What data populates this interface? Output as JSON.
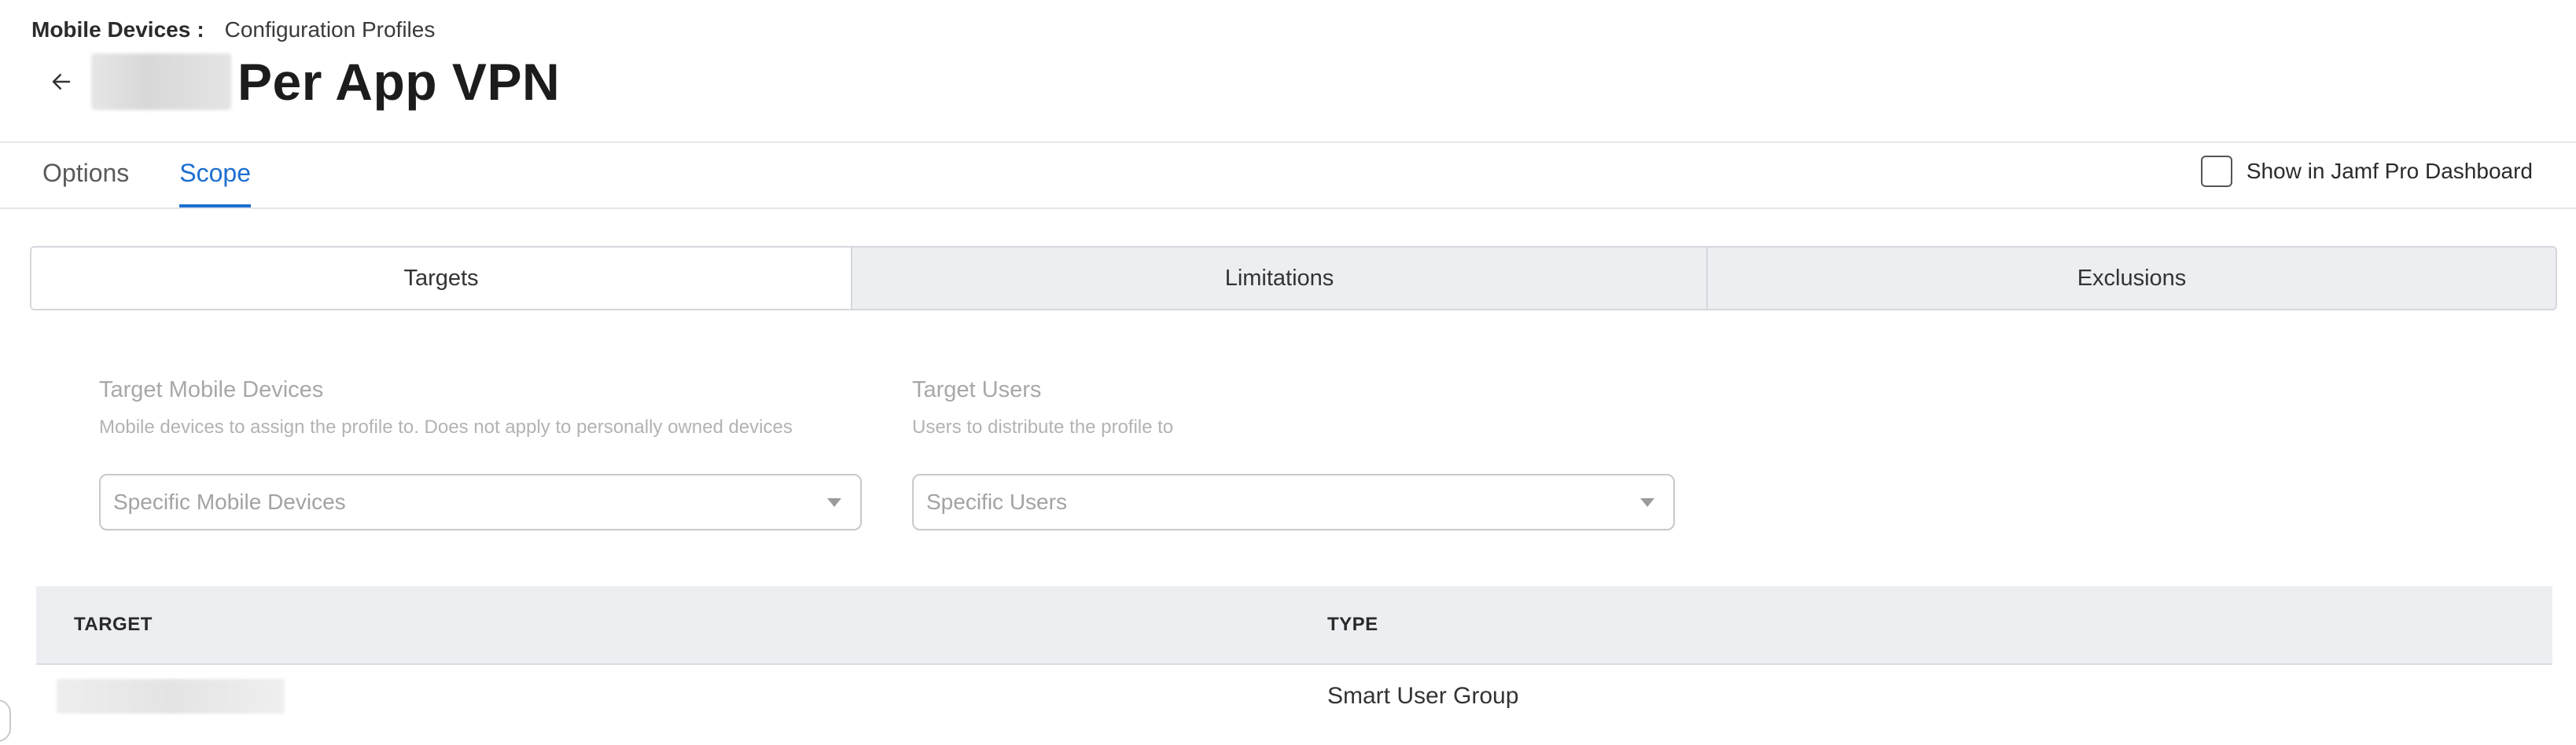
{
  "breadcrumb": {
    "root": "Mobile Devices",
    "separator": ":",
    "current": "Configuration Profiles"
  },
  "header": {
    "title": "Per App VPN",
    "back_icon": "arrow-left-icon"
  },
  "tabs": [
    {
      "label": "Options",
      "active": false
    },
    {
      "label": "Scope",
      "active": true
    }
  ],
  "dashboard_checkbox": {
    "label": "Show in Jamf Pro Dashboard",
    "checked": false
  },
  "scope_sections": [
    {
      "label": "Targets",
      "active": true
    },
    {
      "label": "Limitations",
      "active": false
    },
    {
      "label": "Exclusions",
      "active": false
    }
  ],
  "target_devices": {
    "label": "Target Mobile Devices",
    "description": "Mobile devices to assign the profile to. Does not apply to personally owned devices",
    "selected": "Specific Mobile Devices"
  },
  "target_users": {
    "label": "Target Users",
    "description": "Users to distribute the profile to",
    "selected": "Specific Users"
  },
  "table": {
    "columns": [
      "TARGET",
      "TYPE"
    ],
    "rows": [
      {
        "target": "",
        "type": "Smart User Group"
      }
    ]
  },
  "colors": {
    "accent": "#1d6fd1",
    "segment_inactive_bg": "#eceef2",
    "table_header_bg": "#eceef2"
  }
}
